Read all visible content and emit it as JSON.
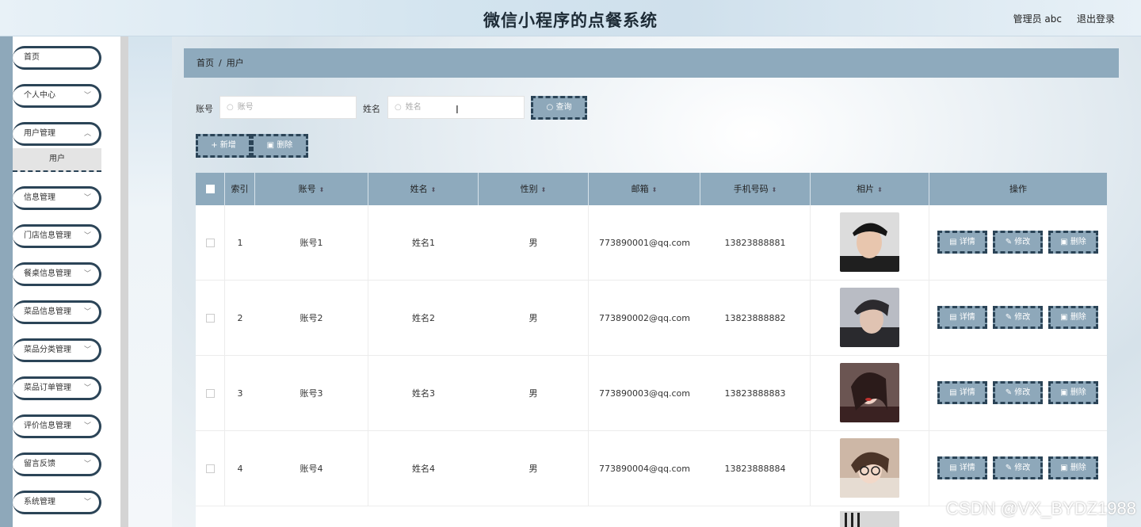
{
  "header": {
    "title": "微信小程序的点餐系统",
    "user_label": "管理员 abc",
    "logout_label": "退出登录"
  },
  "sidebar": {
    "items": [
      {
        "label": "首页",
        "has_chevron": false
      },
      {
        "label": "个人中心",
        "has_chevron": true
      },
      {
        "label": "用户管理",
        "has_chevron": true
      },
      {
        "label": "信息管理",
        "has_chevron": true
      },
      {
        "label": "门店信息管理",
        "has_chevron": true
      },
      {
        "label": "餐桌信息管理",
        "has_chevron": true
      },
      {
        "label": "菜品信息管理",
        "has_chevron": true
      },
      {
        "label": "菜品分类管理",
        "has_chevron": true
      },
      {
        "label": "菜品订单管理",
        "has_chevron": true
      },
      {
        "label": "评价信息管理",
        "has_chevron": true
      },
      {
        "label": "留言反馈",
        "has_chevron": true
      },
      {
        "label": "系统管理",
        "has_chevron": true
      }
    ],
    "submenu_active": "用户"
  },
  "breadcrumb": {
    "home": "首页",
    "separator": "/",
    "current": "用户"
  },
  "search": {
    "account_label": "账号",
    "account_placeholder": "账号",
    "name_label": "姓名",
    "name_placeholder": "姓名",
    "query_button": "查询"
  },
  "toolbar": {
    "add_button": "新增",
    "delete_button": "删除"
  },
  "table": {
    "headers": {
      "index": "索引",
      "account": "账号",
      "name": "姓名",
      "gender": "性别",
      "email": "邮箱",
      "phone": "手机号码",
      "photo": "相片",
      "actions": "操作"
    },
    "rows": [
      {
        "index": "1",
        "account": "账号1",
        "name": "姓名1",
        "gender": "男",
        "email": "773890001@qq.com",
        "phone": "13823888881"
      },
      {
        "index": "2",
        "account": "账号2",
        "name": "姓名2",
        "gender": "男",
        "email": "773890002@qq.com",
        "phone": "13823888882"
      },
      {
        "index": "3",
        "account": "账号3",
        "name": "姓名3",
        "gender": "男",
        "email": "773890003@qq.com",
        "phone": "13823888883"
      },
      {
        "index": "4",
        "account": "账号4",
        "name": "姓名4",
        "gender": "男",
        "email": "773890004@qq.com",
        "phone": "13823888884"
      }
    ],
    "action_labels": {
      "detail": "详情",
      "edit": "修改",
      "delete": "删除"
    }
  },
  "watermark": "CSDN @VX_BYDZ1988",
  "colors": {
    "accent": "#8eaabd",
    "dark_border": "#2b4457"
  }
}
